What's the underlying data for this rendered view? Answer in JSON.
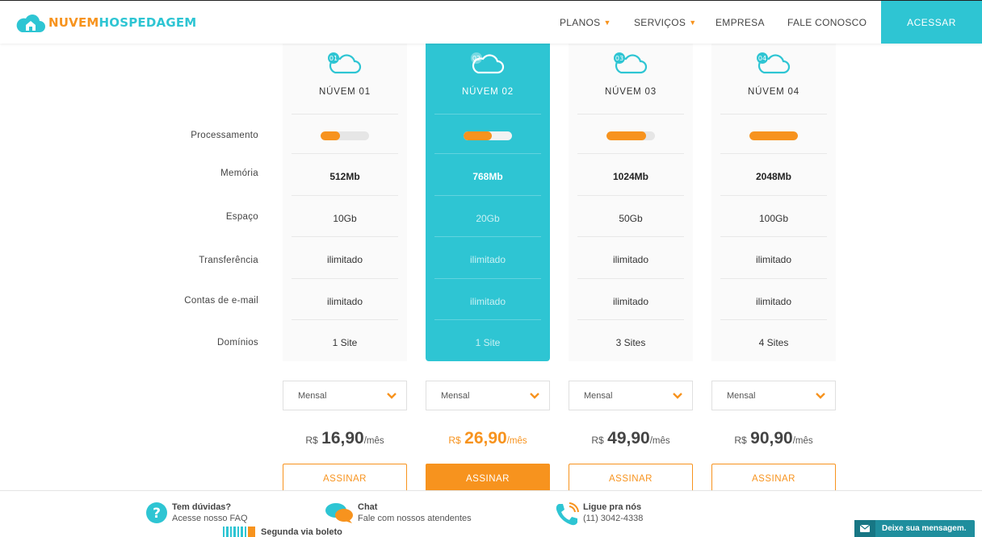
{
  "header": {
    "logo": {
      "part1": "NUVEM",
      "part2": "HOSPEDAGEM"
    },
    "nav": [
      {
        "label": "PLANOS",
        "has_dropdown": true
      },
      {
        "label": "SERVIÇOS",
        "has_dropdown": true
      },
      {
        "label": "EMPRESA",
        "has_dropdown": false
      },
      {
        "label": "FALE CONOSCO",
        "has_dropdown": false
      }
    ],
    "cta_label": "ACESSAR"
  },
  "row_labels": [
    "Processamento",
    "Memória",
    "Espaço",
    "Transferência",
    "Contas de e-mail",
    "Domínios"
  ],
  "plans": [
    {
      "badge": "01",
      "name": "NÚVEM 01",
      "processing": 0.4,
      "memory": "512Mb",
      "space": "10Gb",
      "transfer": "ilimitado",
      "emails": "ilimitado",
      "domains": "1 Site",
      "period": "Mensal",
      "currency": "R$",
      "price": "16,90",
      "per": "/mês",
      "button": "ASSINAR",
      "featured": false
    },
    {
      "badge": "02",
      "name": "NÚVEM 02",
      "processing": 0.58,
      "memory": "768Mb",
      "space": "20Gb",
      "transfer": "ilimitado",
      "emails": "ilimitado",
      "domains": "1 Site",
      "period": "Mensal",
      "currency": "R$",
      "price": "26,90",
      "per": "/mês",
      "button": "ASSINAR",
      "featured": true
    },
    {
      "badge": "03",
      "name": "NÚVEM 03",
      "processing": 0.82,
      "memory": "1024Mb",
      "space": "50Gb",
      "transfer": "ilimitado",
      "emails": "ilimitado",
      "domains": "3 Sites",
      "period": "Mensal",
      "currency": "R$",
      "price": "49,90",
      "per": "/mês",
      "button": "ASSINAR",
      "featured": false
    },
    {
      "badge": "04",
      "name": "NÚVEM 04",
      "processing": 1.0,
      "memory": "2048Mb",
      "space": "100Gb",
      "transfer": "ilimitado",
      "emails": "ilimitado",
      "domains": "4 Sites",
      "period": "Mensal",
      "currency": "R$",
      "price": "90,90",
      "per": "/mês",
      "button": "ASSINAR",
      "featured": false
    }
  ],
  "footer": {
    "faq": {
      "title": "Tem dúvidas?",
      "subtitle": "Acesse nosso FAQ"
    },
    "chat": {
      "title": "Chat",
      "subtitle": "Fale com nossos atendentes"
    },
    "phone": {
      "title": "Ligue pra nós",
      "subtitle": "(11) 3042-4338"
    },
    "boleto": {
      "title": "Segunda via boleto"
    },
    "message_widget": "Deixe sua mensagem."
  },
  "colors": {
    "accent": "#f7931e",
    "brand": "#2ec5d3"
  }
}
